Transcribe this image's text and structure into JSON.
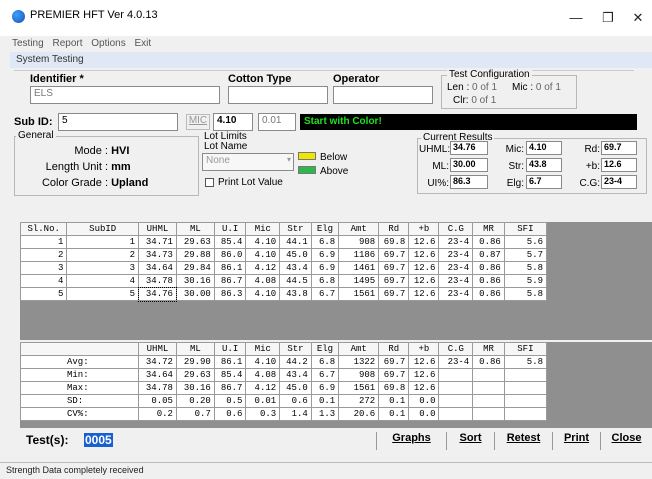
{
  "window": {
    "title": "PREMIER HFT  Ver 4.0.13",
    "minimize": "—",
    "restore": "❐",
    "close": "✕"
  },
  "menu": [
    "Testing",
    "Report",
    "Options",
    "Exit"
  ],
  "panel_title": "System Testing",
  "identifier": {
    "label": "Identifier *",
    "value": "ELS"
  },
  "cotton_type": {
    "label": "Cotton Type",
    "value": ""
  },
  "operator": {
    "label": "Operator",
    "value": ""
  },
  "test_config": {
    "title": "Test Configuration",
    "len_label": "Len :",
    "len_val": "0 of 1",
    "mic_label": "Mic :",
    "mic_val": "0 of 1",
    "clr_label": "Clr:",
    "clr_val": "0 of 1"
  },
  "sub_id": {
    "label": "Sub ID:",
    "value": "5",
    "mic_btn": "MIC",
    "mic_value": "4.10",
    "mic_value2": "0.01"
  },
  "status_message": "Start with Color!",
  "general": {
    "title": "General",
    "mode_label": "Mode :",
    "mode": "HVI",
    "length_label": "Length Unit :",
    "length": "mm",
    "grade_label": "Color Grade :",
    "grade": "Upland"
  },
  "lot_limits": {
    "title": "Lot Limits",
    "lot_name_label": "Lot Name",
    "lot_name": "None",
    "below": "Below",
    "above": "Above",
    "print_lot": "Print Lot Value",
    "below_color": "#f2e600",
    "above_color": "#2fb84a"
  },
  "current_results": {
    "title": "Current Results",
    "uhml_l": "UHML:",
    "uhml": "34.76",
    "ml_l": "ML:",
    "ml": "30.00",
    "ui_l": "UI%:",
    "ui": "86.3",
    "mic_l": "Mic:",
    "mic": "4.10",
    "str_l": "Str:",
    "str": "43.8",
    "elg_l": "Elg:",
    "elg": "6.7",
    "rd_l": "Rd:",
    "rd": "69.7",
    "b_l": "+b:",
    "b": "12.6",
    "cg_l": "C.G:",
    "cg": "23-4"
  },
  "table": {
    "headers": [
      "Sl.No.",
      "SubID",
      "UHML",
      "ML",
      "U.I",
      "Mic",
      "Str",
      "Elg",
      "Amt",
      "Rd",
      "+b",
      "C.G",
      "MR",
      "SFI"
    ],
    "rows": [
      [
        "1",
        "1",
        "34.71",
        "29.63",
        "85.4",
        "4.10",
        "44.1",
        "6.8",
        "908",
        "69.8",
        "12.6",
        "23-4",
        "0.86",
        "5.6"
      ],
      [
        "2",
        "2",
        "34.73",
        "29.88",
        "86.0",
        "4.10",
        "45.0",
        "6.9",
        "1186",
        "69.7",
        "12.6",
        "23-4",
        "0.87",
        "5.7"
      ],
      [
        "3",
        "3",
        "34.64",
        "29.84",
        "86.1",
        "4.12",
        "43.4",
        "6.9",
        "1461",
        "69.7",
        "12.6",
        "23-4",
        "0.86",
        "5.8"
      ],
      [
        "4",
        "4",
        "34.78",
        "30.16",
        "86.7",
        "4.08",
        "44.5",
        "6.8",
        "1495",
        "69.7",
        "12.6",
        "23-4",
        "0.86",
        "5.9"
      ],
      [
        "5",
        "5",
        "34.76",
        "30.00",
        "86.3",
        "4.10",
        "43.8",
        "6.7",
        "1561",
        "69.7",
        "12.6",
        "23-4",
        "0.86",
        "5.8"
      ]
    ]
  },
  "summary": {
    "headers": [
      "",
      "UHML",
      "ML",
      "U.I",
      "Mic",
      "Str",
      "Elg",
      "Amt",
      "Rd",
      "+b",
      "C.G",
      "MR",
      "SFI"
    ],
    "rows": [
      [
        "Avg:",
        "34.72",
        "29.90",
        "86.1",
        "4.10",
        "44.2",
        "6.8",
        "1322",
        "69.7",
        "12.6",
        "23-4",
        "0.86",
        "5.8"
      ],
      [
        "Min:",
        "34.64",
        "29.63",
        "85.4",
        "4.08",
        "43.4",
        "6.7",
        "908",
        "69.7",
        "12.6",
        "",
        "",
        ""
      ],
      [
        "Max:",
        "34.78",
        "30.16",
        "86.7",
        "4.12",
        "45.0",
        "6.9",
        "1561",
        "69.8",
        "12.6",
        "",
        "",
        ""
      ],
      [
        "SD:",
        "0.05",
        "0.20",
        "0.5",
        "0.01",
        "0.6",
        "0.1",
        "272",
        "0.1",
        "0.0",
        "",
        "",
        ""
      ],
      [
        "CV%:",
        "0.2",
        "0.7",
        "0.6",
        "0.3",
        "1.4",
        "1.3",
        "20.6",
        "0.1",
        "0.0",
        "",
        "",
        ""
      ]
    ]
  },
  "tests": {
    "label": "Test(s):",
    "count": "0005"
  },
  "buttons": {
    "graphs": "Graphs",
    "sort": "Sort",
    "retest": "Retest",
    "print": "Print",
    "close": "Close"
  },
  "statusbar": "Strength Data completely received"
}
